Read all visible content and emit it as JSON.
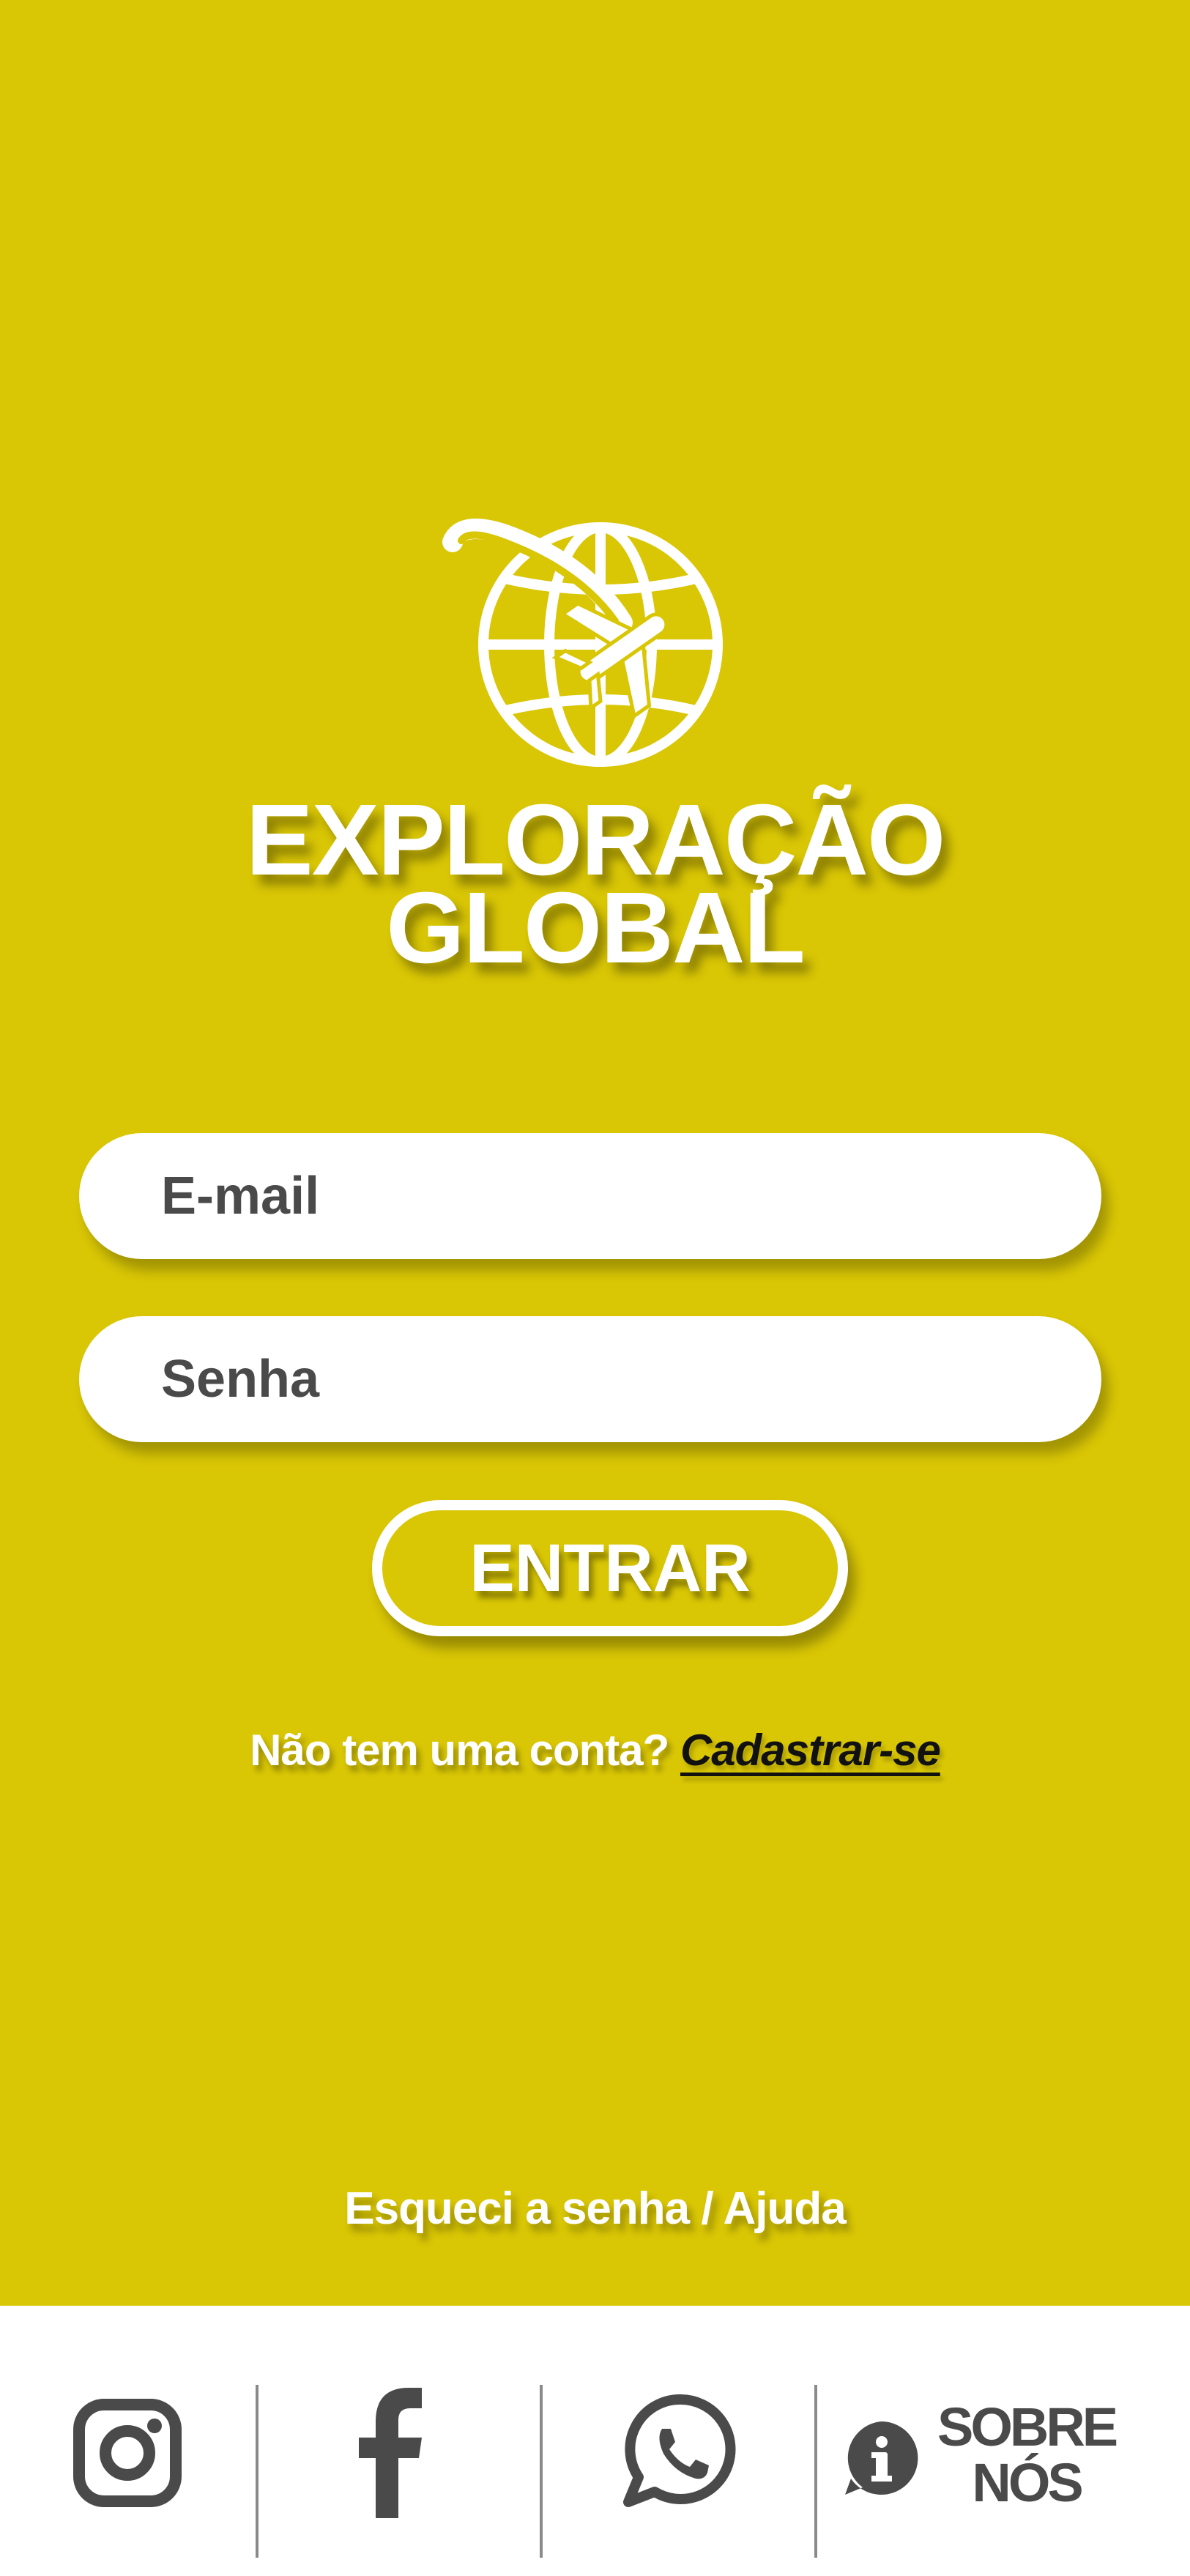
{
  "app": {
    "title_line1": "EXPLORAÇÃO",
    "title_line2": "GLOBAL",
    "logo_icon": "globe-with-airplane-icon"
  },
  "login": {
    "email_placeholder": "E-mail",
    "password_placeholder": "Senha",
    "submit_label": "ENTRAR"
  },
  "signup": {
    "question": "Não tem uma conta?",
    "link_label": "Cadastrar-se"
  },
  "help": {
    "forgot_label": "Esqueci a senha / Ajuda"
  },
  "footer": {
    "items": [
      {
        "icon": "instagram-icon"
      },
      {
        "icon": "facebook-icon"
      },
      {
        "icon": "whatsapp-icon"
      },
      {
        "icon": "info-icon",
        "label_line1": "SOBRE",
        "label_line2": "NÓS"
      }
    ]
  },
  "colors": {
    "background": "#d9c605",
    "text_light": "#ffffff",
    "text_dark": "#4a4a4a",
    "footer_bg": "#ffffff"
  }
}
